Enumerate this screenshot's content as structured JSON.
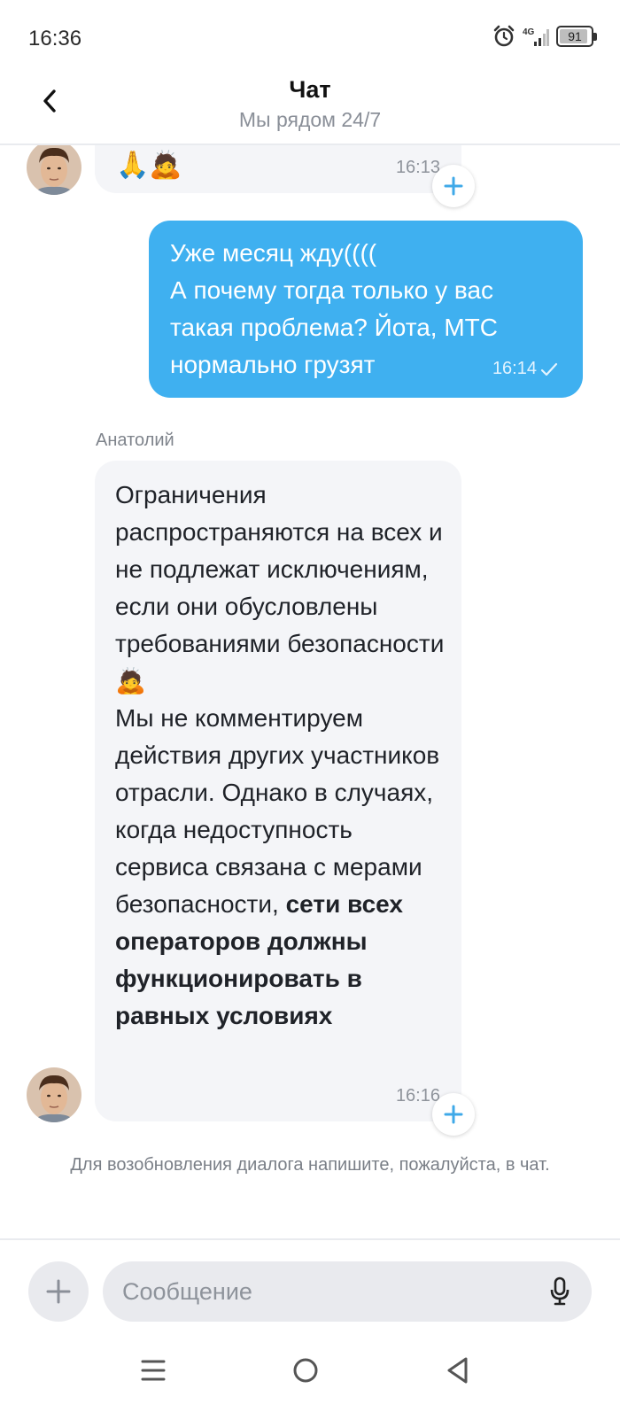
{
  "status_bar": {
    "time": "16:36",
    "network": "4G",
    "battery": "91",
    "battery_level": 0.91,
    "icons": [
      "alarm-icon",
      "signal-icon",
      "battery-icon"
    ]
  },
  "header": {
    "title": "Чат",
    "subtitle": "Мы рядом 24/7",
    "back_icon": "chevron-left-icon"
  },
  "messages": [
    {
      "direction": "incoming",
      "emoji": "🙏🙇",
      "time": "16:13",
      "has_avatar": true,
      "react_icon": "plus-icon"
    },
    {
      "direction": "outgoing",
      "text": "Уже месяц жду((((\nА почему тогда только у вас такая проблема? Йота, МТС нормально грузят",
      "time": "16:14",
      "status_icon": "check-icon"
    },
    {
      "direction": "incoming",
      "sender": "Анатолий",
      "text": "Ограничения распространяются на всех и не подлежат исключениям, если они обусловлены требованиями безопасности 🙇\nМы не комментируем действия других участников отрасли. Однако в случаях, когда недоступность сервиса связана с мерами безопасности, ",
      "text_bold": "сети всех операторов должны функционировать в равных условиях",
      "time": "16:16",
      "has_avatar": true,
      "react_icon": "plus-icon"
    }
  ],
  "system_note": "Для возобновления диалога напишите, пожалуйста, в чат.",
  "composer": {
    "placeholder": "Сообщение",
    "attach_icon": "plus-icon",
    "mic_icon": "microphone-icon"
  },
  "nav_bar": {
    "icons": [
      "menu-icon",
      "home-icon",
      "back-icon"
    ]
  },
  "colors": {
    "outgoing_bubble": "#3fb0f0",
    "incoming_bubble": "#f4f5f8",
    "accent": "#3fa9e8"
  }
}
